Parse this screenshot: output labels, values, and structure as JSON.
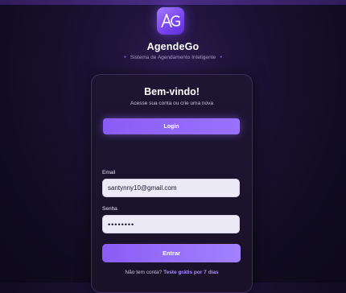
{
  "app": {
    "logo_text": "AG",
    "name": "AgendeGo",
    "tagline": "Sistema de Agendamento Inteligente"
  },
  "card": {
    "title": "Bem-vindo!",
    "subtitle": "Acesse sua conta ou crie uma nova",
    "tab_login_label": "Login"
  },
  "form": {
    "email_label": "Email",
    "email_value": "santynny10@gmail.com",
    "password_label": "Senha",
    "password_value": "••••••••",
    "submit_label": "Entrar"
  },
  "signup": {
    "prompt": "Não tem conta?",
    "link_text": "Teste grátis por 7 dias"
  },
  "colors": {
    "accent": "#8a5cf6",
    "accent_light": "#a889ff",
    "background": "#110c22",
    "card": "#1d1532",
    "input_bg": "#eceaf7"
  }
}
